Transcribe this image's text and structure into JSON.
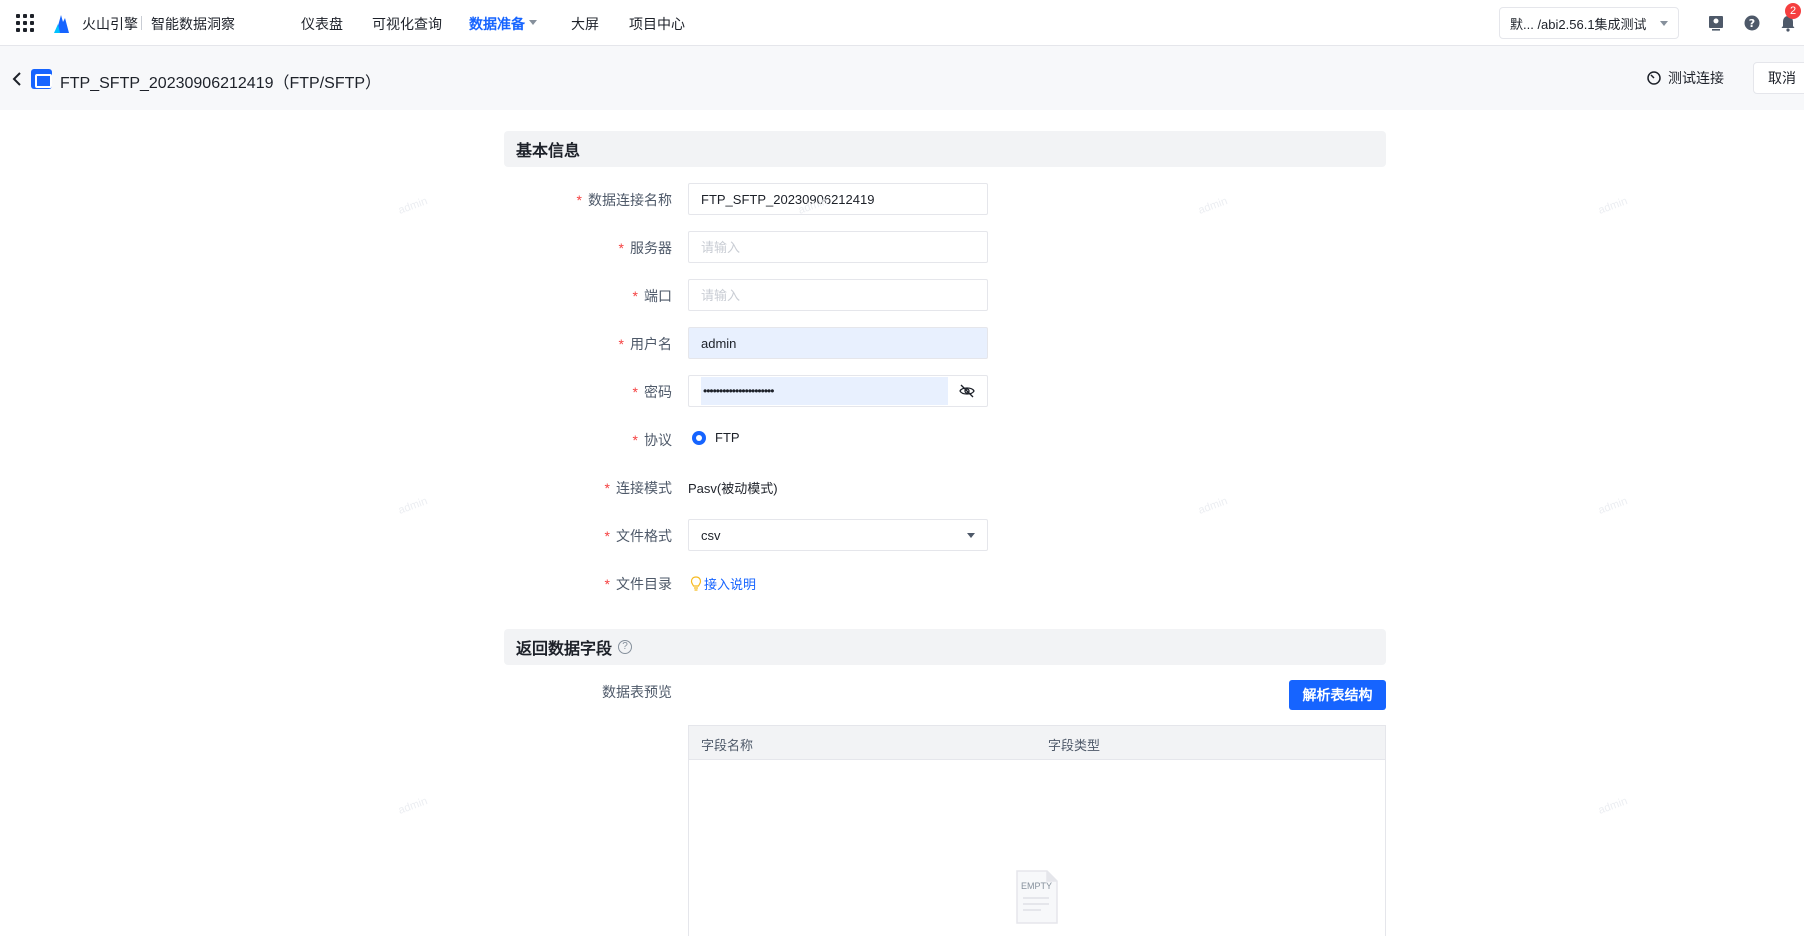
{
  "topbar": {
    "brand": "火山引擎",
    "product": "智能数据洞察",
    "nav": [
      {
        "label": "仪表盘"
      },
      {
        "label": "可视化查询"
      },
      {
        "label": "数据准备",
        "active": true
      },
      {
        "label": "大屏"
      },
      {
        "label": "项目中心"
      }
    ],
    "project": "默... /abi2.56.1集成测试",
    "notification_count": "2"
  },
  "header": {
    "title": "FTP_SFTP_20230906212419（FTP/SFTP）",
    "test_connection": "测试连接",
    "cancel": "取消"
  },
  "basic_info": {
    "section_title": "基本信息",
    "required_mark": "*",
    "fields": {
      "name": {
        "label": "数据连接名称",
        "value": "FTP_SFTP_20230906212419"
      },
      "server": {
        "label": "服务器",
        "placeholder": "请输入"
      },
      "port": {
        "label": "端口",
        "placeholder": "请输入"
      },
      "username": {
        "label": "用户名",
        "value": "admin"
      },
      "password": {
        "label": "密码",
        "value": "••••••••••••••••••••••"
      },
      "protocol": {
        "label": "协议",
        "value": "FTP"
      },
      "mode": {
        "label": "连接模式",
        "value": "Pasv(被动模式)"
      },
      "format": {
        "label": "文件格式",
        "value": "csv"
      },
      "directory": {
        "label": "文件目录",
        "link": "接入说明"
      }
    }
  },
  "return_fields": {
    "section_title": "返回数据字段",
    "help_mark": "?",
    "preview_label": "数据表预览",
    "parse_button": "解析表结构",
    "columns": [
      "字段名称",
      "字段类型"
    ],
    "empty_text": "EMPTY"
  },
  "watermark": "admin",
  "colors": {
    "primary": "#1664ff",
    "required": "#f53f3f",
    "section_bg": "#f2f3f5"
  }
}
